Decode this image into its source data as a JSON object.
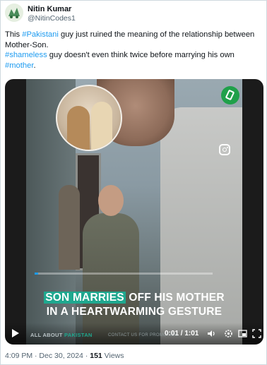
{
  "author": {
    "name": "Nitin Kumar",
    "handle": "@NitinCodes1",
    "avatar_icon": "avatar-icon"
  },
  "tweet": {
    "line1_prefix": "This ",
    "line1_hashtag": "#Pakistani",
    "line1_suffix": " guy just ruined the meaning of the relationship between",
    "line2": "Mother-Son.",
    "line3_hashtag": "#shameless",
    "line3_suffix": " guy doesn't even think twice before marrying his own",
    "line4_hashtag": "#mother",
    "line4_suffix": "."
  },
  "video": {
    "caption_highlight": "SON MARRIES",
    "caption_rest_line1": " OFF HIS MOTHER",
    "caption_line2": "IN A HEARTWARMING GESTURE",
    "brand_prefix": "ALL ABOUT ",
    "brand_accent": "PAKISTAN",
    "promo_text": "CONTACT US FOR PROMOTION",
    "time": "0:01 / 1:01",
    "progress_percent": 2,
    "accent_color": "#1fa88f"
  },
  "footer": {
    "timestamp": "4:09 PM · Dec 30, 2024 · ",
    "views_count": "151",
    "views_label": " Views"
  }
}
